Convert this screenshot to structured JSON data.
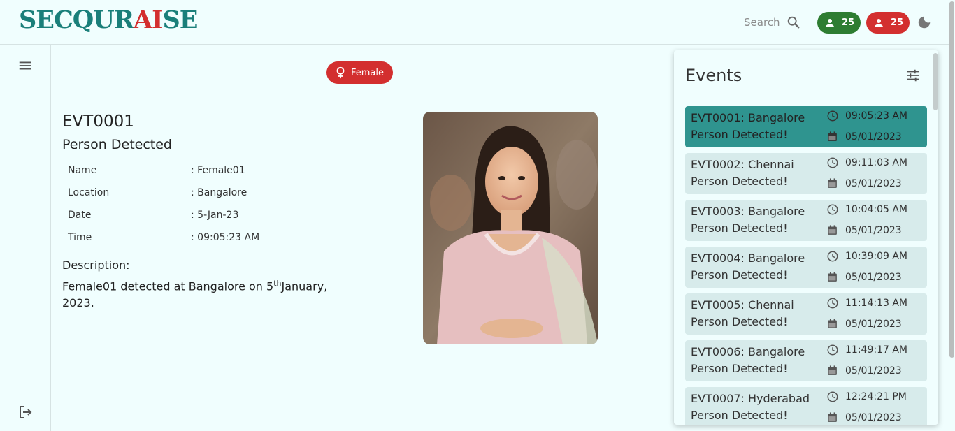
{
  "brand": {
    "part1": "SECQUR",
    "part2": "AI",
    "part3": "SE"
  },
  "header": {
    "search_label": "Search",
    "male_count": "25",
    "female_count": "25",
    "colors": {
      "green": "#2e7d32",
      "red": "#d32f2f",
      "teal": "#1a7f7a"
    }
  },
  "detail": {
    "gender_chip": "Female",
    "event_id": "EVT0001",
    "event_type": "Person Detected",
    "fields": [
      {
        "label": "Name",
        "value": ": Female01"
      },
      {
        "label": "Location",
        "value": ": Bangalore"
      },
      {
        "label": "Date",
        "value": ": 5-Jan-23"
      },
      {
        "label": "Time",
        "value": ": 09:05:23 AM"
      }
    ],
    "description_label": "Description:",
    "description_pre": "Female01 detected at Bangalore on 5",
    "description_sup": "th",
    "description_post": "January, 2023."
  },
  "events": {
    "title": "Events",
    "items": [
      {
        "title": "EVT0001: Bangalore",
        "subtitle": "Person Detected!",
        "time": "09:05:23 AM",
        "date": "05/01/2023",
        "active": true
      },
      {
        "title": "EVT0002: Chennai",
        "subtitle": "Person Detected!",
        "time": "09:11:03 AM",
        "date": "05/01/2023",
        "active": false
      },
      {
        "title": "EVT0003: Bangalore",
        "subtitle": "Person Detected!",
        "time": "10:04:05 AM",
        "date": "05/01/2023",
        "active": false
      },
      {
        "title": "EVT0004: Bangalore",
        "subtitle": "Person Detected!",
        "time": "10:39:09 AM",
        "date": "05/01/2023",
        "active": false
      },
      {
        "title": "EVT0005: Chennai",
        "subtitle": "Person Detected!",
        "time": "11:14:13 AM",
        "date": "05/01/2023",
        "active": false
      },
      {
        "title": "EVT0006: Bangalore",
        "subtitle": "Person Detected!",
        "time": "11:49:17 AM",
        "date": "05/01/2023",
        "active": false
      },
      {
        "title": "EVT0007: Hyderabad",
        "subtitle": "Person Detected!",
        "time": "12:24:21 PM",
        "date": "05/01/2023",
        "active": false
      }
    ]
  },
  "icons": {
    "menu": "menu-icon",
    "logout": "logout-icon",
    "search": "search-icon",
    "person": "person-icon",
    "moon": "moon-icon",
    "filter": "filter-icon",
    "clock": "clock-icon",
    "calendar": "calendar-icon",
    "female": "female-icon"
  }
}
